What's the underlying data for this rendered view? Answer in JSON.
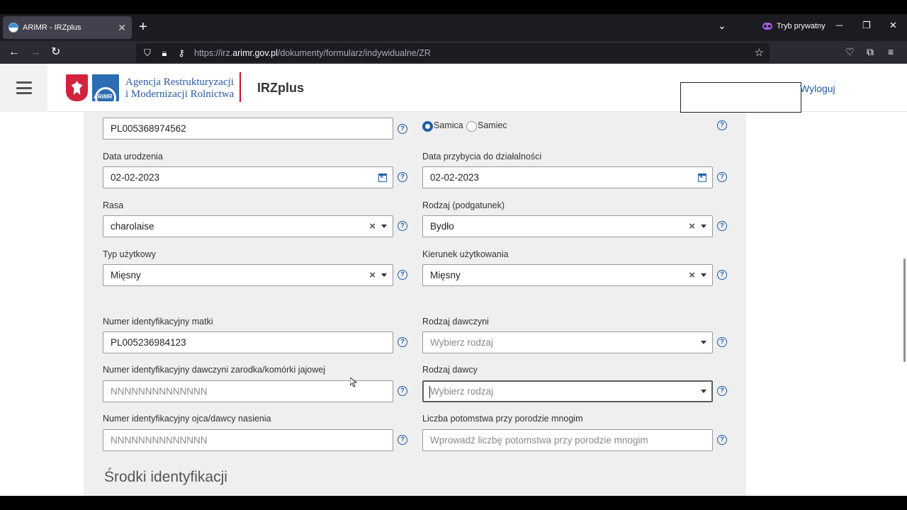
{
  "browser": {
    "tab_title": "ARiMR - IRZplus",
    "new_tab": "+",
    "private_label": "Tryb prywatny",
    "url_prefix": "https://irz.",
    "url_domain": "arimr.gov.pl",
    "url_path": "/dokumenty/formularz/indywidualne/ZR"
  },
  "header": {
    "agency_line1": "Agencja Restrukturyzacji",
    "agency_line2": "i Modernizacji Rolnictwa",
    "logo_text": "ARiMR",
    "app_name": "IRZplus",
    "logout": "Wyloguj"
  },
  "form": {
    "animal_id_value": "PL005368974562",
    "sex_female": "Samica",
    "sex_male": "Samiec",
    "birth_date_label": "Data urodzenia",
    "birth_date_value": "02-02-2023",
    "arrival_date_label": "Data przybycia do działalności",
    "arrival_date_value": "02-02-2023",
    "breed_label": "Rasa",
    "breed_value": "charolaise",
    "species_label": "Rodzaj (podgatunek)",
    "species_value": "Bydło",
    "utility_type_label": "Typ użytkowy",
    "utility_type_value": "Mięsny",
    "use_direction_label": "Kierunek użytkowania",
    "use_direction_value": "Mięsny",
    "mother_id_label": "Numer identyfikacyjny matki",
    "mother_id_value": "PL005236984123",
    "donor_type_label": "Rodzaj dawczyni",
    "donor_type_placeholder": "Wybierz rodzaj",
    "embryo_donor_label": "Numer identyfikacyjny dawczyni zarodka/komórki jajowej",
    "embryo_donor_placeholder": "NNNNNNNNNNNNNN",
    "sire_type_label": "Rodzaj dawcy",
    "sire_type_placeholder": "Wybierz rodzaj",
    "father_id_label": "Numer identyfikacyjny ojca/dawcy nasienia",
    "father_id_placeholder": "NNNNNNNNNNNNNN",
    "offspring_label": "Liczba potomstwa przy porodzie mnogim",
    "offspring_placeholder": "Wprowadź liczbę potomstwa przy porodzie mnogim",
    "section_title": "Środki identyfikacji",
    "help_glyph": "?"
  }
}
